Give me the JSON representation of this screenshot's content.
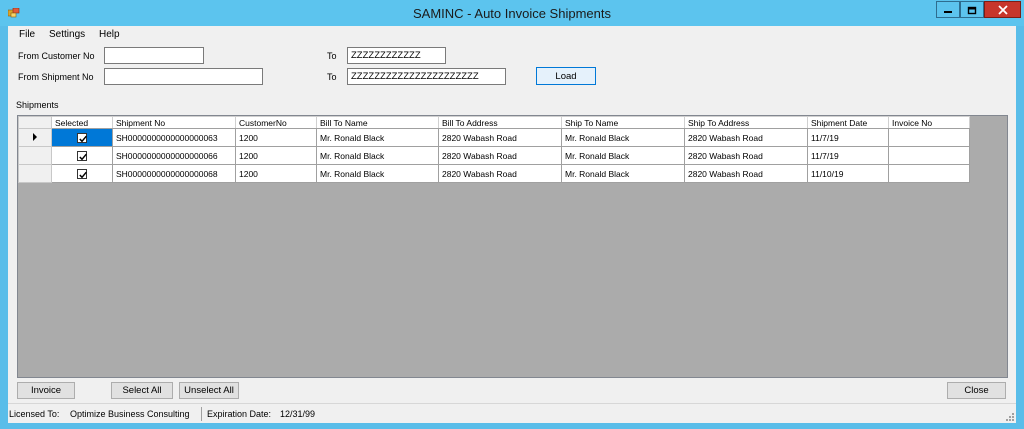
{
  "window": {
    "title": "SAMINC - Auto Invoice Shipments"
  },
  "menu": {
    "file": "File",
    "settings": "Settings",
    "help": "Help"
  },
  "filters": {
    "from_customer_label": "From Customer No",
    "from_customer_value": "",
    "to_customer_label": "To",
    "to_customer_value": "ZZZZZZZZZZZZ",
    "from_shipment_label": "From Shipment No",
    "from_shipment_value": "",
    "to_shipment_label": "To",
    "to_shipment_value": "ZZZZZZZZZZZZZZZZZZZZZZ",
    "load_label": "Load"
  },
  "shipments": {
    "label": "Shipments",
    "columns": [
      "Selected",
      "Shipment No",
      "CustomerNo",
      "Bill To Name",
      "Bill To Address",
      "Ship To Name",
      "Ship To Address",
      "Shipment Date",
      "Invoice No"
    ],
    "rows": [
      {
        "selected": true,
        "shipment_no": "SH0000000000000000063",
        "customer_no": "1200",
        "bill_to_name": "Mr. Ronald Black",
        "bill_to_address": "2820 Wabash Road",
        "ship_to_name": "Mr. Ronald Black",
        "ship_to_address": "2820 Wabash Road",
        "shipment_date": "11/7/19",
        "invoice_no": ""
      },
      {
        "selected": true,
        "shipment_no": "SH0000000000000000066",
        "customer_no": "1200",
        "bill_to_name": "Mr. Ronald Black",
        "bill_to_address": "2820 Wabash Road",
        "ship_to_name": "Mr. Ronald Black",
        "ship_to_address": "2820 Wabash Road",
        "shipment_date": "11/7/19",
        "invoice_no": ""
      },
      {
        "selected": true,
        "shipment_no": "SH0000000000000000068",
        "customer_no": "1200",
        "bill_to_name": "Mr. Ronald Black",
        "bill_to_address": "2820 Wabash Road",
        "ship_to_name": "Mr. Ronald Black",
        "ship_to_address": "2820 Wabash Road",
        "shipment_date": "11/10/19",
        "invoice_no": ""
      }
    ]
  },
  "buttons": {
    "invoice": "Invoice",
    "select_all": "Select All",
    "unselect_all": "Unselect All",
    "close": "Close"
  },
  "status": {
    "licensed_to_label": "Licensed To:",
    "licensed_to_value": "Optimize Business Consulting",
    "expiration_label": "Expiration Date:",
    "expiration_value": "12/31/99"
  },
  "colors": {
    "title_bar": "#5cc4ee",
    "close_button": "#c7362b",
    "selection": "#0078d7",
    "grid_background": "#ababab"
  }
}
